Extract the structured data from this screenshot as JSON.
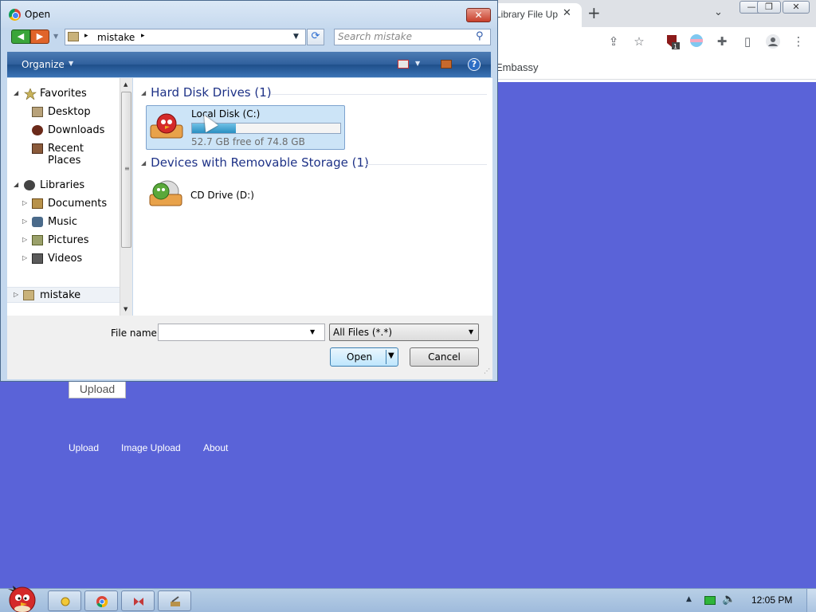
{
  "browser": {
    "tab_title": "Library File Up",
    "tab_close": "✕",
    "new_tab": "+",
    "tab_search": "⌄",
    "window_controls": [
      "—",
      "❐",
      "✕"
    ],
    "bookmark": "Embassy",
    "toolbar_icons": [
      "share-icon",
      "star-icon",
      "extension-badge-icon",
      "color-icon",
      "puzzle-icon",
      "sidepanel-icon",
      "profile-icon",
      "menu-icon"
    ],
    "extension_badge": "1"
  },
  "page": {
    "upload_button": "Upload",
    "links": [
      "Upload",
      "Image Upload",
      "About"
    ],
    "background_color": "#5a63d8"
  },
  "dialog": {
    "title": "Open",
    "close": "✕",
    "address": {
      "path": "mistake",
      "sep": "▸"
    },
    "search_placeholder": "Search mistake",
    "organize": "Organize",
    "organize_arrow": "▼",
    "help": "?",
    "nav": {
      "favorites": "Favorites",
      "desktop": "Desktop",
      "downloads": "Downloads",
      "recent_places": "Recent Places",
      "libraries": "Libraries",
      "documents": "Documents",
      "music": "Music",
      "pictures": "Pictures",
      "videos": "Videos",
      "mistake": "mistake"
    },
    "groups": {
      "hard_disks": "Hard Disk Drives (1)",
      "removable": "Devices with Removable Storage (1)"
    },
    "drive_c": {
      "label": "Local Disk (C:)",
      "free": "52.7 GB free of 74.8 GB",
      "used_fraction": 0.295
    },
    "drive_d": {
      "label": "CD Drive (D:)"
    },
    "file_name_label": "File name:",
    "file_name_value": "",
    "file_type": "All Files (*.*)",
    "open_button": "Open",
    "cancel_button": "Cancel"
  },
  "taskbar": {
    "clock": "12:05 PM",
    "tray_up": "▲"
  }
}
